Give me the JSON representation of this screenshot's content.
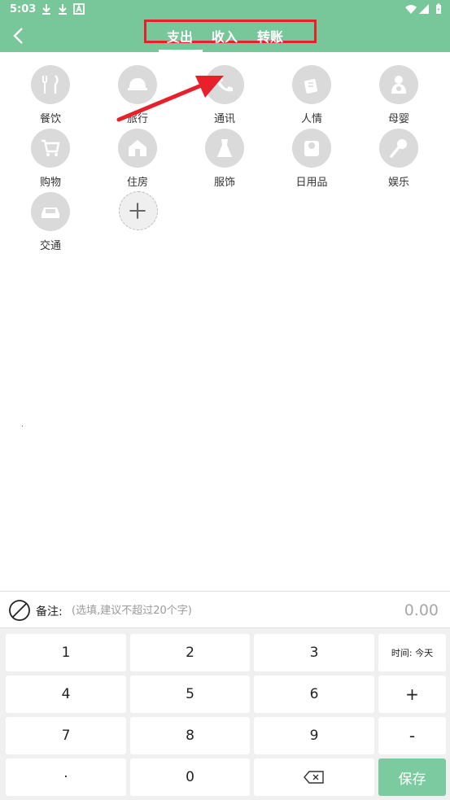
{
  "status": {
    "time": "5:03"
  },
  "header": {
    "tabs": [
      {
        "label": "支出"
      },
      {
        "label": "收入"
      },
      {
        "label": "转账"
      }
    ]
  },
  "categories": [
    {
      "label": "餐饮",
      "icon": "utensils-icon"
    },
    {
      "label": "旅行",
      "icon": "helmet-icon"
    },
    {
      "label": "通讯",
      "icon": "phone-icon"
    },
    {
      "label": "人情",
      "icon": "gift-icon"
    },
    {
      "label": "母婴",
      "icon": "baby-icon"
    },
    {
      "label": "购物",
      "icon": "cart-icon"
    },
    {
      "label": "住房",
      "icon": "house-icon"
    },
    {
      "label": "服饰",
      "icon": "dress-icon"
    },
    {
      "label": "日用品",
      "icon": "tissue-icon"
    },
    {
      "label": "娱乐",
      "icon": "microphone-icon"
    },
    {
      "label": "交通",
      "icon": "car-icon"
    }
  ],
  "note": {
    "label": "备注:",
    "placeholder": "(选填,建议不超过20个字)",
    "amount": "0.00"
  },
  "keypad": {
    "k1": "1",
    "k2": "2",
    "k3": "3",
    "time": "时间: 今天",
    "k4": "4",
    "k5": "5",
    "k6": "6",
    "plus": "+",
    "k7": "7",
    "k8": "8",
    "k9": "9",
    "minus": "-",
    "dot": "·",
    "k0": "0",
    "save": "保存"
  },
  "colors": {
    "header": "#78c79a",
    "save": "#7ccba0",
    "annotation": "#e8202c"
  }
}
